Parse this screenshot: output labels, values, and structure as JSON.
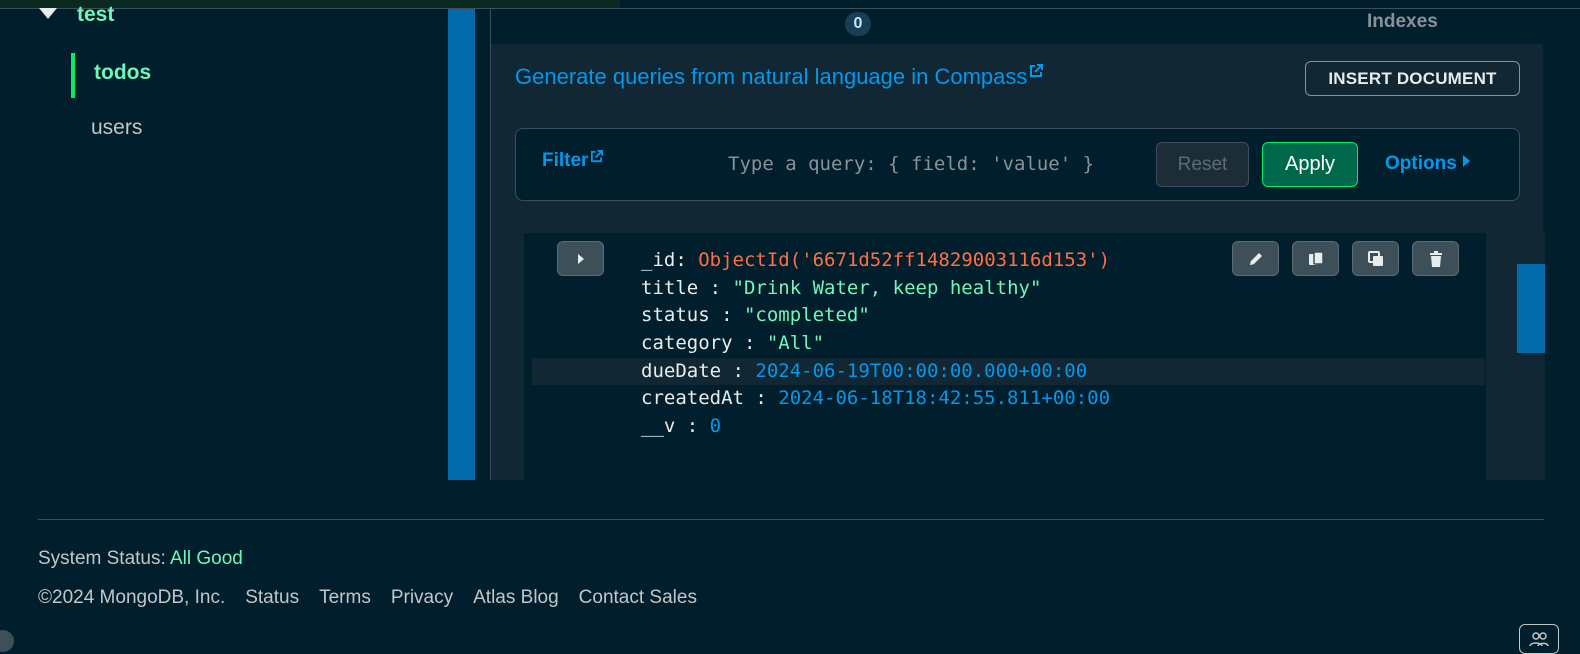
{
  "sidebar": {
    "database": "test",
    "collections": [
      {
        "label": "todos",
        "active": true
      },
      {
        "label": "users",
        "active": false
      }
    ]
  },
  "tabs": {
    "documents_count": "0",
    "indexes_label": "Indexes"
  },
  "header": {
    "nl_query_link": "Generate queries from natural language in Compass",
    "insert_button": "INSERT DOCUMENT"
  },
  "filter": {
    "label": "Filter",
    "placeholder": "Type a query: { field: 'value' }",
    "reset_label": "Reset",
    "apply_label": "Apply",
    "options_label": "Options"
  },
  "document": {
    "fields": [
      {
        "key": "_id",
        "sep": ": ",
        "value": "ObjectId('6671d52ff14829003116d153')",
        "type": "oid"
      },
      {
        "key": "title",
        "sep": " : ",
        "value": "\"Drink Water, keep healthy\"",
        "type": "str"
      },
      {
        "key": "status",
        "sep": " : ",
        "value": "\"completed\"",
        "type": "str"
      },
      {
        "key": "category",
        "sep": " : ",
        "value": "\"All\"",
        "type": "str"
      },
      {
        "key": "dueDate",
        "sep": " : ",
        "value": "2024-06-19T00:00:00.000+00:00",
        "type": "date"
      },
      {
        "key": "createdAt",
        "sep": " : ",
        "value": "2024-06-18T18:42:55.811+00:00",
        "type": "date"
      },
      {
        "key": "__v",
        "sep": " : ",
        "value": "0",
        "type": "num"
      }
    ],
    "actions": [
      "edit-icon",
      "copy-icon",
      "clone-icon",
      "delete-icon"
    ]
  },
  "footer": {
    "status_prefix": "System Status: ",
    "status_value": "All Good",
    "copyright": "©2024 MongoDB, Inc.",
    "links": [
      "Status",
      "Terms",
      "Privacy",
      "Atlas Blog",
      "Contact Sales"
    ]
  },
  "colors": {
    "background": "#001e2b",
    "accent_green": "#71f6ba",
    "link_blue": "#0498ec",
    "apply_green": "#00684a",
    "objectid_orange": "#ff6f44"
  }
}
